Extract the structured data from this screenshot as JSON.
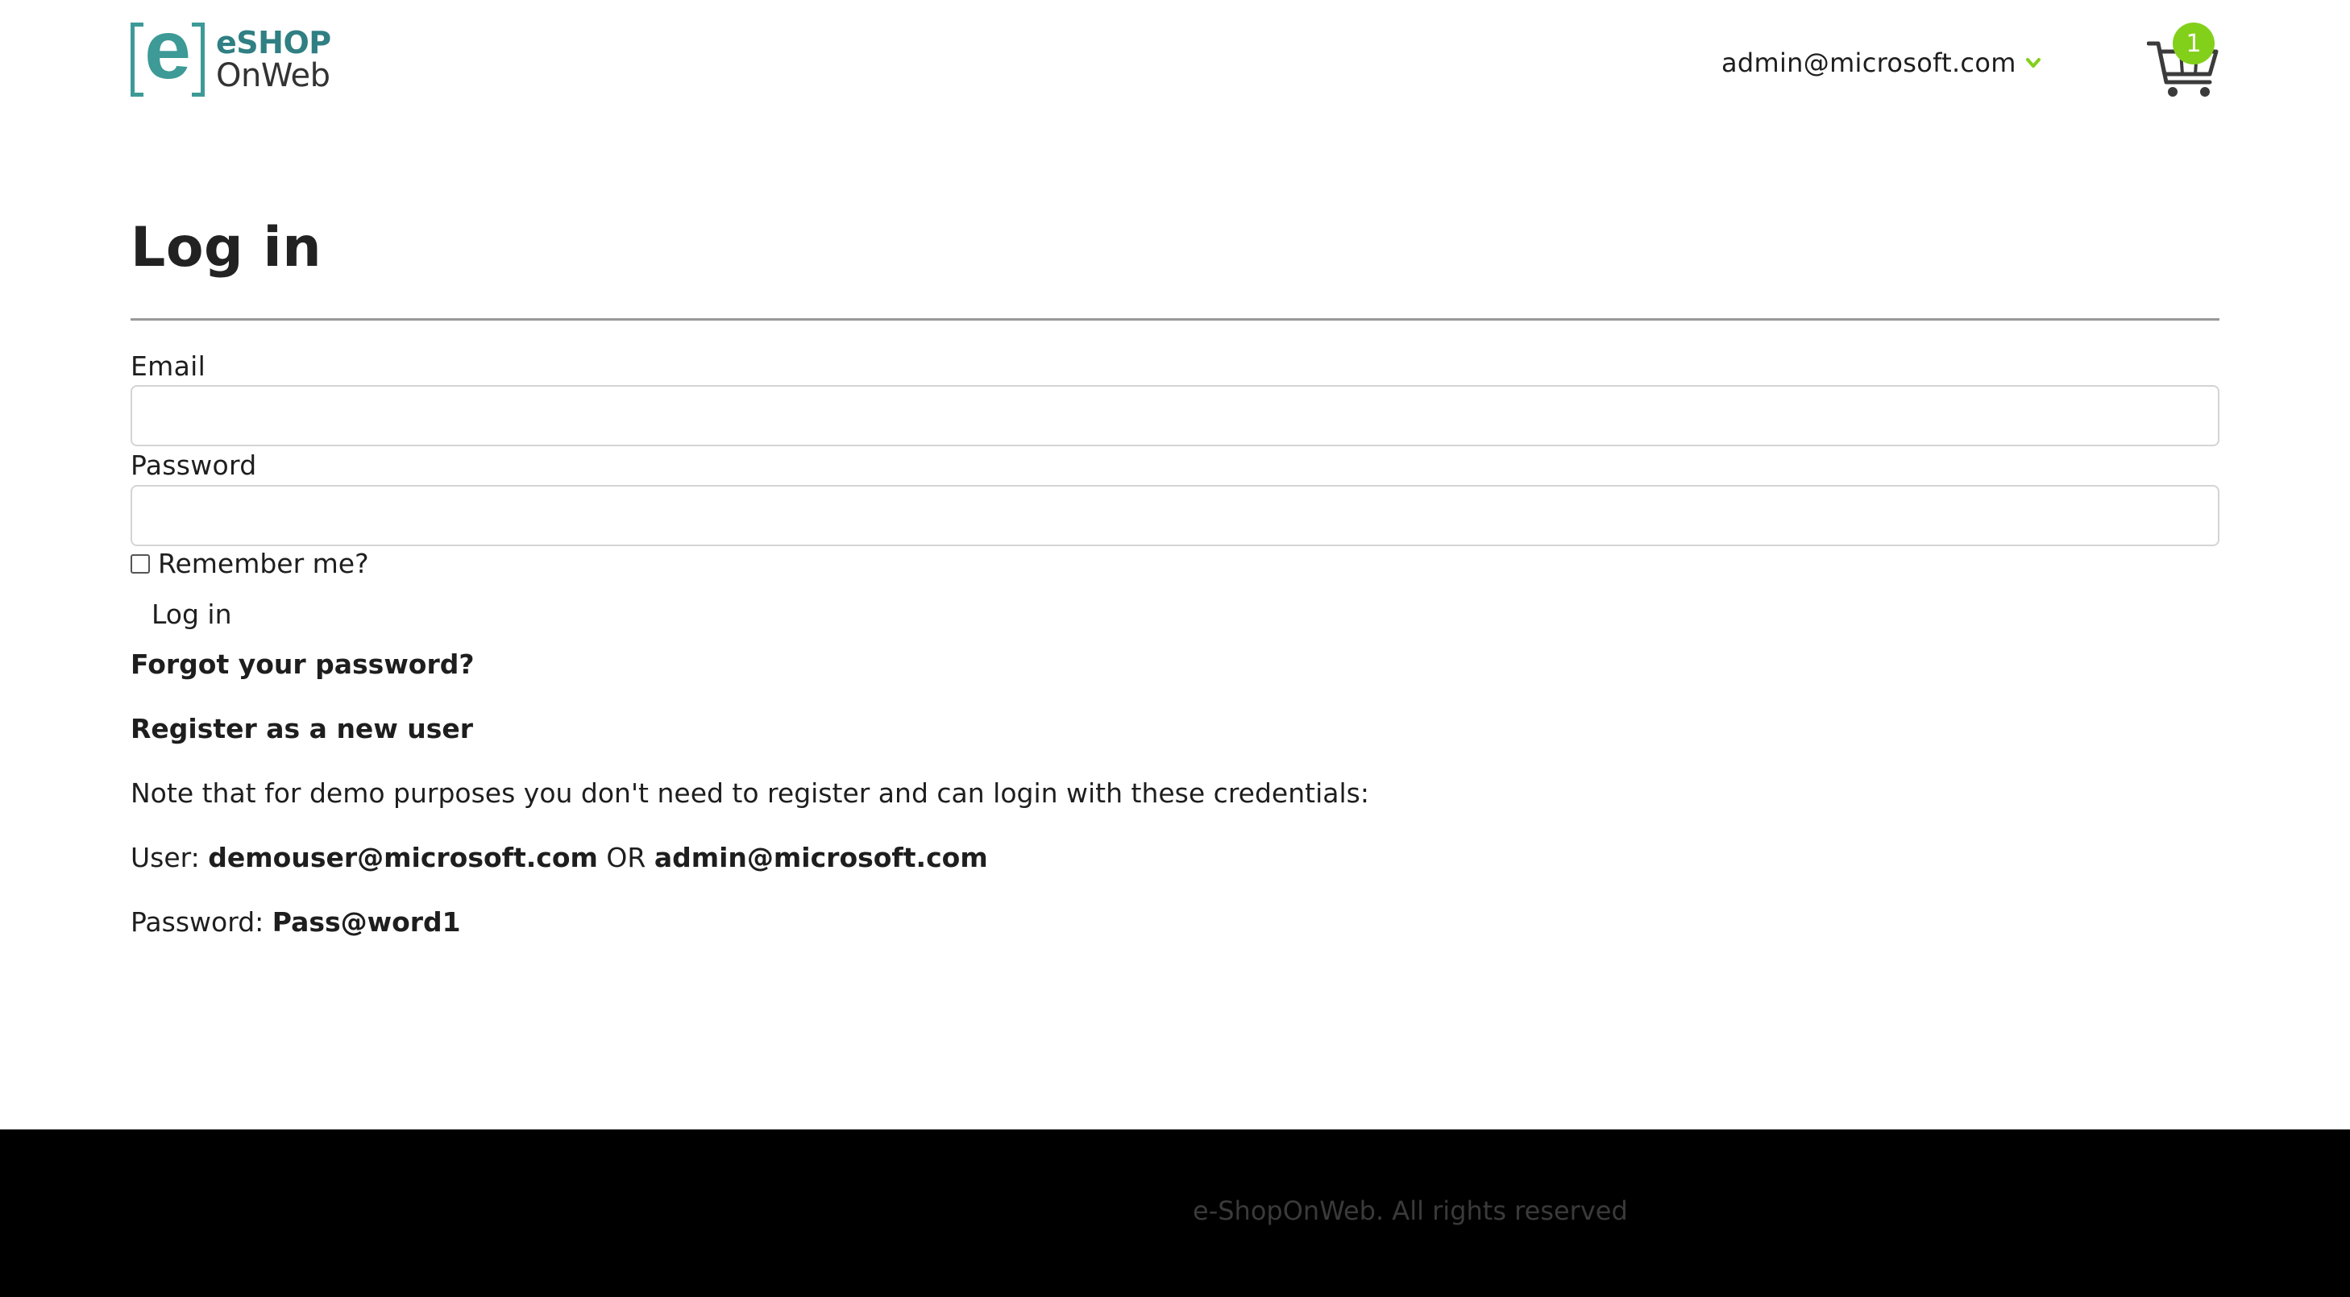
{
  "header": {
    "logo": {
      "line1": "eSHOP",
      "line2": "OnWeb",
      "mark_letter": "e"
    },
    "user_email": "admin@microsoft.com",
    "cart_count": "1"
  },
  "form": {
    "title": "Log in",
    "email_label": "Email",
    "email_value": "",
    "password_label": "Password",
    "password_value": "",
    "remember_label": "Remember me?",
    "remember_checked": false,
    "login_button": "Log in",
    "forgot_link": "Forgot your password?",
    "register_link": "Register as a new user"
  },
  "demo_note": {
    "intro": "Note that for demo purposes you don't need to register and can login with these credentials:",
    "user_prefix": "User:",
    "user1": "demouser@microsoft.com",
    "or": "OR",
    "user2": "admin@microsoft.com",
    "password_prefix": "Password:",
    "password": "Pass@word1"
  },
  "footer": {
    "copyright": "e-ShopOnWeb. All rights reserved"
  },
  "colors": {
    "brand_teal": "#3d9a96",
    "cart_badge": "#83d01b",
    "footer_bg": "#000000"
  },
  "icons": [
    "eshop-logo-icon",
    "chevron-down-icon",
    "cart-icon"
  ]
}
